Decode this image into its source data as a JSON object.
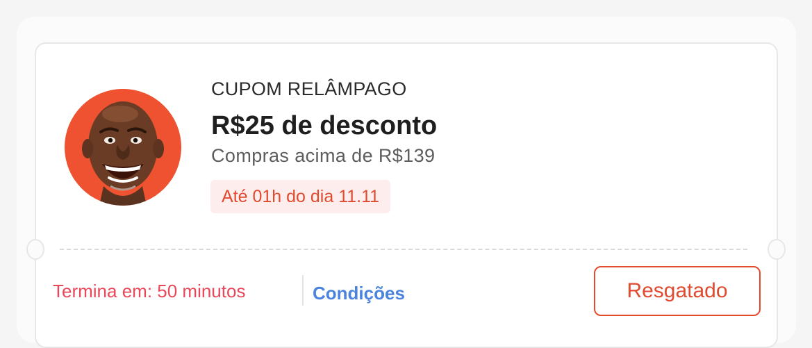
{
  "coupon": {
    "eyebrow": "CUPOM RELÂMPAGO",
    "headline": "R$25 de desconto",
    "subline": "Compras acima de R$139",
    "expiry_badge": "Até 01h do dia 11.11",
    "countdown": "Termina em: 50 minutos",
    "conditions_label": "Condições",
    "redeemed_label": "Resgatado",
    "avatar_icon": "smiling-man-avatar"
  },
  "colors": {
    "accent": "#e04a2f",
    "countdown": "#e9485a",
    "link": "#4a84dc",
    "badge_bg": "#fdeeed",
    "avatar_bg": "#ee5230"
  }
}
